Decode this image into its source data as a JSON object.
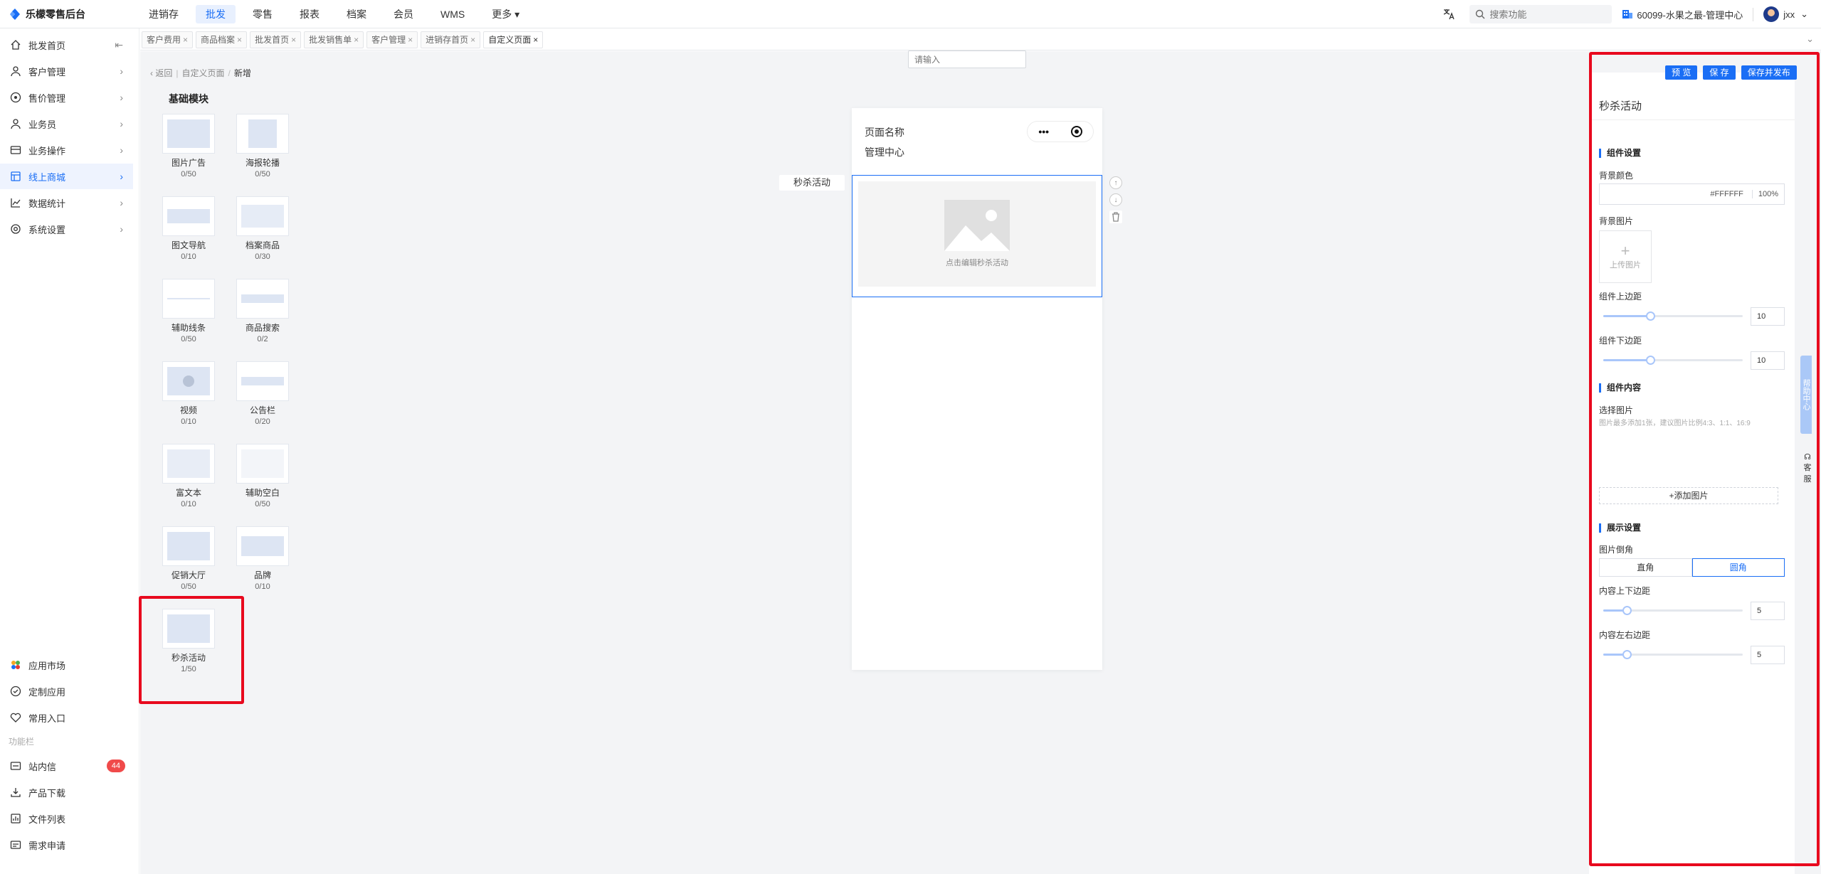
{
  "app": {
    "title": "乐檬零售后台"
  },
  "topnav": {
    "items": [
      "进销存",
      "批发",
      "零售",
      "报表",
      "档案",
      "会员",
      "WMS",
      "更多"
    ]
  },
  "header": {
    "search_placeholder": "搜索功能",
    "store": "60099-水果之最-管理中心",
    "user": "jxx"
  },
  "sidebar": {
    "items": [
      {
        "label": "批发首页",
        "icon": "home-icon"
      },
      {
        "label": "客户管理",
        "icon": "user-icon"
      },
      {
        "label": "售价管理",
        "icon": "price-icon"
      },
      {
        "label": "业务员",
        "icon": "person-icon"
      },
      {
        "label": "业务操作",
        "icon": "operation-icon"
      },
      {
        "label": "线上商城",
        "icon": "shop-icon"
      },
      {
        "label": "数据统计",
        "icon": "chart-icon"
      },
      {
        "label": "系统设置",
        "icon": "settings-icon"
      }
    ],
    "bottom": [
      {
        "label": "应用市场",
        "icon": "app-market-icon"
      },
      {
        "label": "定制应用",
        "icon": "custom-app-icon"
      },
      {
        "label": "常用入口",
        "icon": "heart-icon"
      }
    ],
    "section_label": "功能栏",
    "tools": [
      {
        "label": "站内信",
        "icon": "message-icon",
        "badge": "44"
      },
      {
        "label": "产品下载",
        "icon": "download-icon"
      },
      {
        "label": "文件列表",
        "icon": "file-list-icon"
      },
      {
        "label": "需求申请",
        "icon": "request-icon"
      }
    ]
  },
  "tabs": [
    "客户费用",
    "商品档案",
    "批发首页",
    "批发销售单",
    "客户管理",
    "进销存首页",
    "自定义页面"
  ],
  "breadcrumb": {
    "back": "返回",
    "parent": "自定义页面",
    "current": "新增"
  },
  "modules": {
    "title": "基础模块",
    "items": [
      {
        "name": "图片广告",
        "count": "0/50"
      },
      {
        "name": "海报轮播",
        "count": "0/50"
      },
      {
        "name": "图文导航",
        "count": "0/10"
      },
      {
        "name": "档案商品",
        "count": "0/30"
      },
      {
        "name": "辅助线条",
        "count": "0/50"
      },
      {
        "name": "商品搜索",
        "count": "0/2"
      },
      {
        "name": "视频",
        "count": "0/10"
      },
      {
        "name": "公告栏",
        "count": "0/20"
      },
      {
        "name": "富文本",
        "count": "0/10"
      },
      {
        "name": "辅助空白",
        "count": "0/50"
      },
      {
        "name": "促销大厅",
        "count": "0/50"
      },
      {
        "name": "品牌",
        "count": "0/10"
      },
      {
        "name": "秒杀活动",
        "count": "1/50"
      }
    ]
  },
  "canvas": {
    "input_placeholder": "请输入",
    "page_name": "页面名称",
    "page_sub": "管理中心",
    "capsule_dots": "•••",
    "block_label": "秒杀活动",
    "block_hint": "点击编辑秒杀活动"
  },
  "actions": {
    "preview": "预 览",
    "save": "保 存",
    "publish": "保存并发布"
  },
  "settings": {
    "title": "秒杀活动",
    "component_settings": "组件设置",
    "bg_color_label": "背景颜色",
    "bg_color_value": "#FFFFFF",
    "bg_opacity": "100%",
    "bg_image_label": "背景图片",
    "upload_plus": "+",
    "upload_label": "上传图片",
    "margin_top_label": "组件上边距",
    "margin_top_value": "10",
    "margin_bottom_label": "组件下边距",
    "margin_bottom_value": "10",
    "component_content": "组件内容",
    "select_image_label": "选择图片",
    "select_image_note": "图片最多添加1张，建议图片比例4:3、1:1、16:9",
    "add_image": "+添加图片",
    "display_settings": "展示设置",
    "corner_label": "图片倒角",
    "corner_options": [
      "直角",
      "圆角"
    ],
    "corner_selected": "圆角",
    "padding_v_label": "内容上下边距",
    "padding_v_value": "5",
    "padding_h_label": "内容左右边距",
    "padding_h_value": "5"
  },
  "float": {
    "help_tab": "帮助中心",
    "service": "客服"
  },
  "colors": {
    "accent": "#1a6ef5",
    "highlight": "#e8091e",
    "badge": "#f04a4a"
  }
}
